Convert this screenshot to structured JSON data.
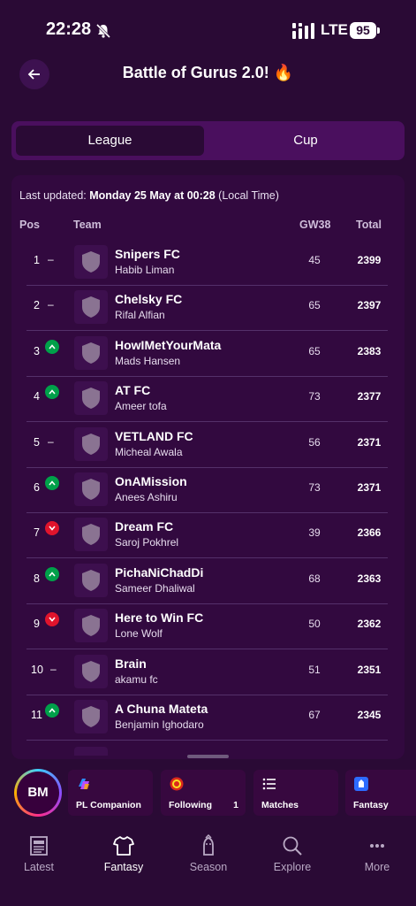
{
  "status": {
    "time": "22:28",
    "network": "LTE",
    "battery": "95"
  },
  "header": {
    "title": "Battle of Gurus 2.0! 🔥"
  },
  "tabs": [
    {
      "label": "League",
      "active": true
    },
    {
      "label": "Cup",
      "active": false
    }
  ],
  "updated": {
    "prefix": "Last updated:",
    "date": "Monday 25 May at 00:28",
    "suffix": "(Local Time)"
  },
  "columns": {
    "pos": "Pos",
    "team": "Team",
    "gw": "GW38",
    "total": "Total"
  },
  "rows": [
    {
      "pos": "1",
      "move": "same",
      "team": "Snipers FC",
      "manager": "Habib Liman",
      "gw": "45",
      "total": "2399"
    },
    {
      "pos": "2",
      "move": "same",
      "team": "Chelsky FC",
      "manager": "Rifal Alfian",
      "gw": "65",
      "total": "2397"
    },
    {
      "pos": "3",
      "move": "up",
      "team": "HowIMetYourMata",
      "manager": "Mads Hansen",
      "gw": "65",
      "total": "2383"
    },
    {
      "pos": "4",
      "move": "up",
      "team": "AT FC",
      "manager": "Ameer tofa",
      "gw": "73",
      "total": "2377"
    },
    {
      "pos": "5",
      "move": "same",
      "team": "VETLAND FC",
      "manager": "Micheal Awala",
      "gw": "56",
      "total": "2371"
    },
    {
      "pos": "6",
      "move": "up",
      "team": "OnAMission",
      "manager": "Anees Ashiru",
      "gw": "73",
      "total": "2371"
    },
    {
      "pos": "7",
      "move": "down",
      "team": "Dream FC",
      "manager": "Saroj Pokhrel",
      "gw": "39",
      "total": "2366"
    },
    {
      "pos": "8",
      "move": "up",
      "team": "PichaNiChadDi",
      "manager": "Sameer Dhaliwal",
      "gw": "68",
      "total": "2363"
    },
    {
      "pos": "9",
      "move": "down",
      "team": "Here to Win FC",
      "manager": "Lone Wolf",
      "gw": "50",
      "total": "2362"
    },
    {
      "pos": "10",
      "move": "same",
      "team": "Brain",
      "manager": "akamu fc",
      "gw": "51",
      "total": "2351"
    },
    {
      "pos": "11",
      "move": "up",
      "team": "A Chuna Mateta",
      "manager": "Benjamin Ighodaro",
      "gw": "67",
      "total": "2345"
    }
  ],
  "user": {
    "initials": "BM"
  },
  "shortcuts": [
    {
      "label": "PL Companion",
      "icon": "copilot-icon"
    },
    {
      "label": "Following",
      "count": "1",
      "icon": "man-utd-crest-icon"
    },
    {
      "label": "Matches",
      "icon": "list-icon"
    },
    {
      "label": "Fantasy",
      "icon": "pl-lion-icon"
    }
  ],
  "nav": [
    {
      "label": "Latest",
      "active": false
    },
    {
      "label": "Fantasy",
      "active": true
    },
    {
      "label": "Season",
      "active": false
    },
    {
      "label": "Explore",
      "active": false
    },
    {
      "label": "More",
      "active": false
    }
  ],
  "colors": {
    "background": "#2a0a35",
    "card": "#32093f",
    "up": "#00a04a",
    "down": "#e0142c"
  }
}
